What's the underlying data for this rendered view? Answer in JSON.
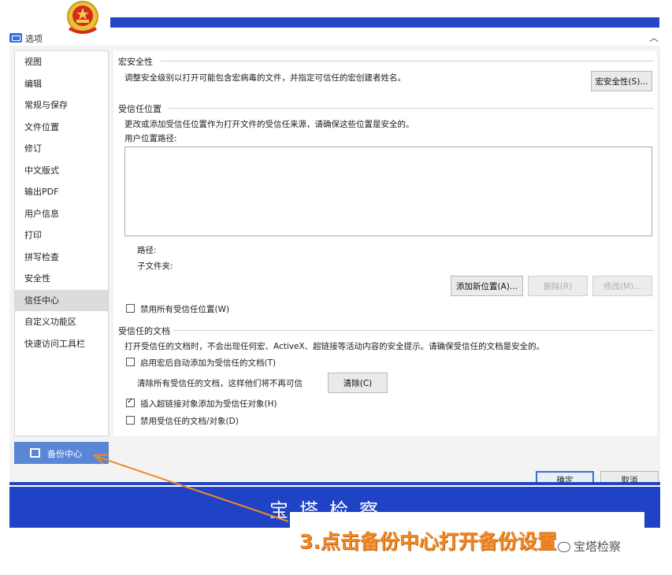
{
  "window": {
    "title": "选项"
  },
  "sidebar": {
    "items": [
      {
        "label": "视图"
      },
      {
        "label": "编辑"
      },
      {
        "label": "常规与保存"
      },
      {
        "label": "文件位置"
      },
      {
        "label": "修订"
      },
      {
        "label": "中文版式"
      },
      {
        "label": "输出PDF"
      },
      {
        "label": "用户信息"
      },
      {
        "label": "打印"
      },
      {
        "label": "拼写检查"
      },
      {
        "label": "安全性"
      },
      {
        "label": "信任中心"
      },
      {
        "label": "自定义功能区"
      },
      {
        "label": "快速访问工具栏"
      }
    ],
    "selected": "信任中心"
  },
  "backup": {
    "label": "备份中心"
  },
  "macro_security": {
    "header": "宏安全性",
    "description": "调整安全级别以打开可能包含宏病毒的文件，并指定可信任的宏创建者姓名。",
    "button_label": "宏安全性(S)..."
  },
  "trusted_locations": {
    "header": "受信任位置",
    "description": "更改或添加受信任位置作为打开文件的受信任来源，请确保这些位置是安全的。",
    "path_list_label": "用户位置路径:",
    "path_label": "路径:",
    "subfolder_label": "子文件夹:",
    "add_button": "添加新位置(A)...",
    "delete_button": "删除(R)",
    "modify_button": "修改(M)...",
    "disable_all_label": "禁用所有受信任位置(W)",
    "disable_all_checked": false
  },
  "trusted_documents": {
    "header": "受信任的文档",
    "description": "打开受信任的文档时，不会出现任何宏、ActiveX、超链接等活动内容的安全提示。请确保受信任的文档是安全的。",
    "auto_add_label": "启用宏后自动添加为受信任的文档(T)",
    "auto_add_checked": false,
    "clear_text": "清除所有受信任的文档，这样他们将不再可信",
    "clear_button": "清除(C)",
    "insert_link_label": "插入超链接对象添加为受信任对象(H)",
    "insert_link_checked": true,
    "disable_label": "禁用受信任的文档/对象(D)",
    "disable_checked": false
  },
  "footer": {
    "ok_label": "确定",
    "cancel_label": "取消"
  },
  "banner": {
    "text": "宝塔检察"
  },
  "annotation": {
    "text": "3.点击备份中心打开备份设置"
  },
  "watermark": {
    "text": "宝塔检察"
  },
  "colors": {
    "banner_blue": "#1f43c4",
    "accent_blue": "#5a86d6",
    "annotation_orange": "#f08a26"
  }
}
